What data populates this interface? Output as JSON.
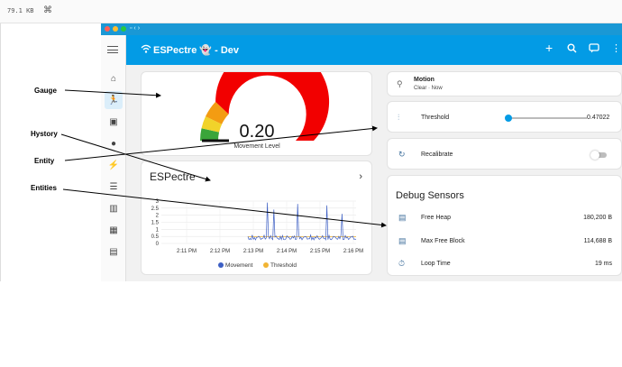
{
  "file_info": {
    "size": "79.1 KB",
    "command_glyph": "⌘"
  },
  "annotations": {
    "gauge": "Gauge",
    "history": "Hystory",
    "entity": "Entity",
    "entities": "Entities"
  },
  "app": {
    "title": "ESPectre 👻 - Dev",
    "toolbar_icons": [
      "add-icon",
      "search-icon",
      "assist-icon",
      "more-icon"
    ]
  },
  "sidebar": {
    "items": [
      "overview-icon",
      "sensor-icon",
      "person-icon",
      "lightning-icon",
      "energy-icon",
      "list-icon",
      "chart-icon",
      "calendar-icon",
      "media-icon"
    ]
  },
  "gauge": {
    "value": "0.20",
    "value_num": 0.2,
    "label": "Movement Level"
  },
  "history": {
    "title": "ESPectre",
    "legend": [
      "Movement",
      "Threshold"
    ],
    "y_ticks": [
      "3",
      "2.5",
      "2",
      "1.5",
      "1",
      "0.5",
      "0"
    ],
    "x_ticks": [
      "2:11 PM",
      "2:12 PM",
      "2:13 PM",
      "2:14 PM",
      "2:15 PM",
      "2:16 PM"
    ]
  },
  "chart_data": {
    "type": "line",
    "title": "ESPectre",
    "x": [
      "2:11 PM",
      "2:12 PM",
      "2:13 PM",
      "2:14 PM",
      "2:15 PM",
      "2:16 PM"
    ],
    "series": [
      {
        "name": "Movement",
        "values": [
          0,
          0,
          0.2,
          0.3,
          0.3,
          0.3
        ],
        "peaks": [
          2.9,
          2.4,
          2.8,
          2.7,
          2.1
        ]
      },
      {
        "name": "Threshold",
        "values": [
          0.47,
          0.47,
          0.47,
          0.47,
          0.47,
          0.47
        ]
      }
    ],
    "ylim": [
      0,
      3
    ],
    "colors": {
      "Movement": "#3d5fc4",
      "Threshold": "#f1b434"
    }
  },
  "motion": {
    "title": "Motion",
    "state": "Clear · Now"
  },
  "threshold": {
    "label": "Threshold",
    "value": "0.47022",
    "fraction": 0.0
  },
  "recalibrate": {
    "label": "Recalibrate",
    "on": false
  },
  "debug": {
    "title": "Debug Sensors",
    "rows": [
      {
        "label": "Free Heap",
        "value": "180,200 B"
      },
      {
        "label": "Max Free Block",
        "value": "114,688 B"
      },
      {
        "label": "Loop Time",
        "value": "19 ms"
      }
    ]
  },
  "colors": {
    "accent": "#039be5",
    "gauge_red": "#f20000",
    "gauge_orange": "#f39c12",
    "gauge_yellow": "#f1d32a",
    "gauge_green": "#3aa53a"
  }
}
